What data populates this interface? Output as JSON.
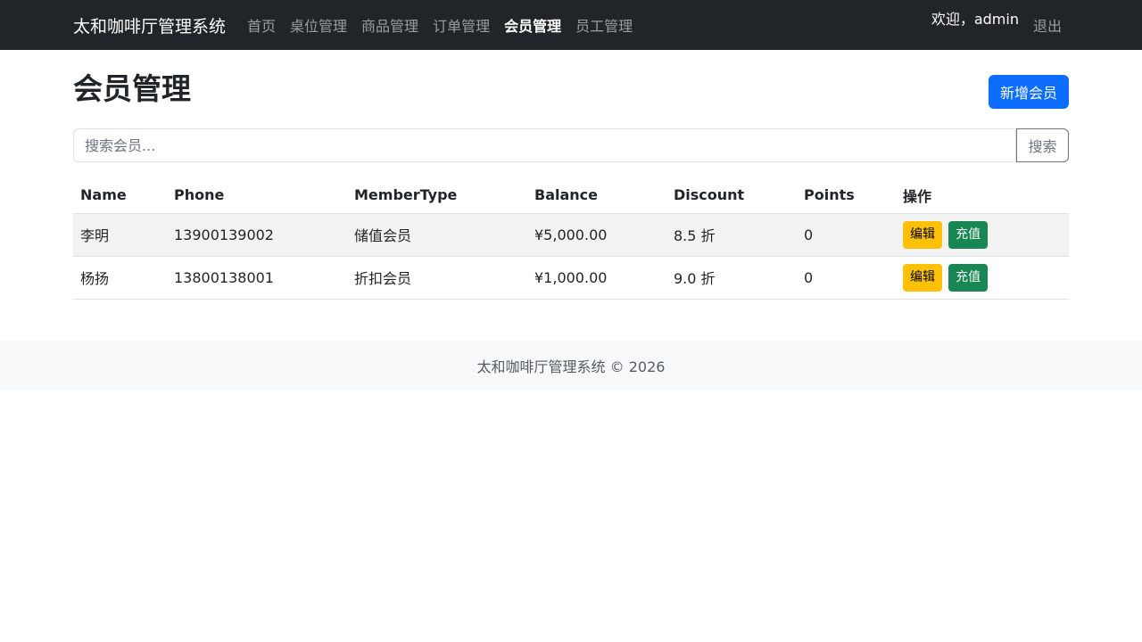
{
  "navbar": {
    "brand": "太和咖啡厅管理系统",
    "links": [
      {
        "label": "首页",
        "active": false
      },
      {
        "label": "桌位管理",
        "active": false
      },
      {
        "label": "商品管理",
        "active": false
      },
      {
        "label": "订单管理",
        "active": false
      },
      {
        "label": "会员管理",
        "active": true
      },
      {
        "label": "员工管理",
        "active": false
      }
    ],
    "welcome": "欢迎，admin",
    "logout": "退出"
  },
  "page": {
    "title": "会员管理",
    "add_button": "新增会员"
  },
  "search": {
    "placeholder": "搜索会员...",
    "value": "",
    "button": "搜索"
  },
  "table": {
    "headers": [
      "Name",
      "Phone",
      "MemberType",
      "Balance",
      "Discount",
      "Points",
      "操作"
    ],
    "rows": [
      {
        "name": "李明",
        "phone": "13900139002",
        "type": "储值会员",
        "balance": "¥5,000.00",
        "discount": "8.5 折",
        "points": "0",
        "edit": "编辑",
        "recharge": "充值"
      },
      {
        "name": "杨扬",
        "phone": "13800138001",
        "type": "折扣会员",
        "balance": "¥1,000.00",
        "discount": "9.0 折",
        "points": "0",
        "edit": "编辑",
        "recharge": "充值"
      }
    ]
  },
  "footer": {
    "text": "太和咖啡厅管理系统 © 2026"
  },
  "colors": {
    "navbar_bg": "#212529",
    "primary": "#0d6efd",
    "warning": "#ffc107",
    "success": "#198754",
    "footer_bg": "#f8f9fa"
  }
}
